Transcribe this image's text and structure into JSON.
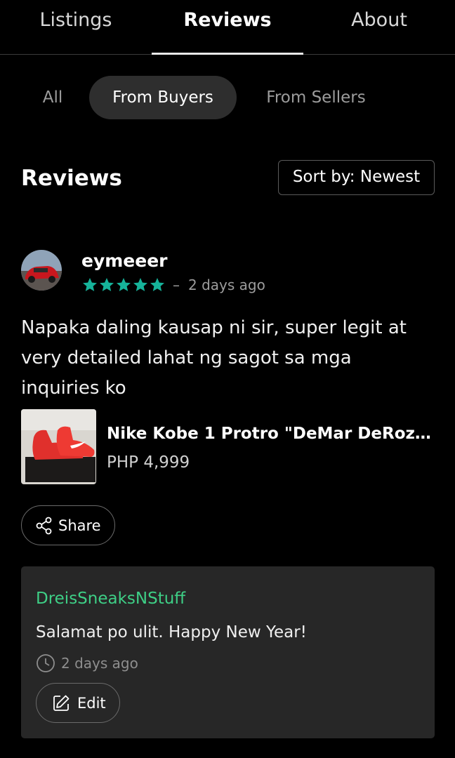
{
  "top_tabs": [
    {
      "label": "Listings"
    },
    {
      "label": "Reviews"
    },
    {
      "label": "About"
    }
  ],
  "active_top_tab": "Reviews",
  "filters": [
    {
      "label": "All"
    },
    {
      "label": "From Buyers"
    },
    {
      "label": "From Sellers"
    }
  ],
  "active_filter": "From Buyers",
  "section": {
    "title": "Reviews",
    "sort_label": "Sort by: Newest"
  },
  "review": {
    "username": "eymeeer",
    "rating": 5,
    "rating_max": 5,
    "separator": "–",
    "time": "2 days ago",
    "text": "Napaka daling kausap ni sir, super legit at very detailed lahat ng sagot sa mga inquiries ko",
    "product": {
      "title": "Nike Kobe 1 Protro \"DeMar DeRoza...",
      "price": "PHP 4,999"
    },
    "share_label": "Share"
  },
  "reply": {
    "name": "DreisSneaksNStuff",
    "text": "Salamat po ulit. Happy New Year!",
    "time": "2 days ago",
    "edit_label": "Edit"
  },
  "colors": {
    "background": "#000000",
    "star": "#16b39a",
    "seller_name": "#3ecf86",
    "card": "#272727"
  },
  "icons": {
    "share": "share-icon",
    "clock": "clock-icon",
    "edit": "edit-icon",
    "star": "star-icon"
  }
}
